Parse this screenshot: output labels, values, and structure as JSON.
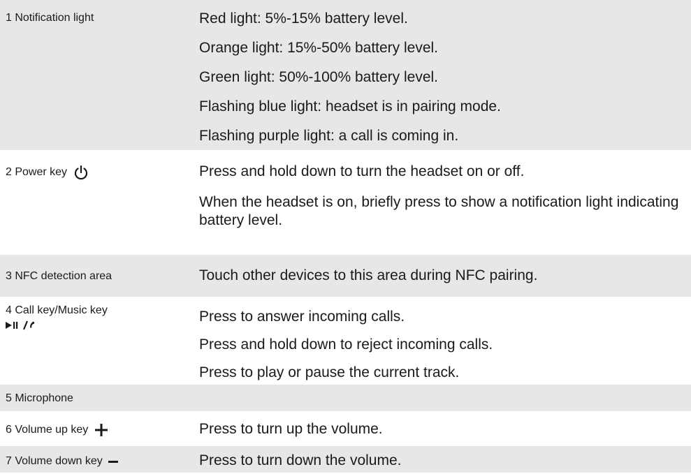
{
  "rows": [
    {
      "label": "1 Notification light",
      "descriptions": [
        "Red light: 5%-15% battery level.",
        "Orange light: 15%-50% battery level.",
        "Green light: 50%-100% battery level.",
        "Flashing blue light: headset is in pairing mode.",
        "Flashing purple light: a call is coming in."
      ]
    },
    {
      "label": "2 Power key",
      "icon": "power-icon",
      "descriptions": [
        "Press and hold down to turn the headset on or off.",
        "When the headset is on, briefly press to show a notification light indicating battery level."
      ]
    },
    {
      "label": "3 NFC detection area",
      "descriptions": [
        "Touch other devices to this area during NFC pairing."
      ]
    },
    {
      "label": "4 Call key/Music key",
      "icon": "play-pause-call-icon",
      "descriptions": [
        "Press to answer incoming calls.",
        "Press and hold down to reject incoming calls.",
        "Press to play or pause the current track."
      ]
    },
    {
      "label": "5 Microphone",
      "descriptions": []
    },
    {
      "label": "6 Volume up key",
      "icon": "plus-icon",
      "descriptions": [
        "Press to turn up the volume."
      ]
    },
    {
      "label": "7 Volume down key",
      "icon": "minus-icon",
      "descriptions": [
        "Press to turn down the volume."
      ]
    }
  ]
}
